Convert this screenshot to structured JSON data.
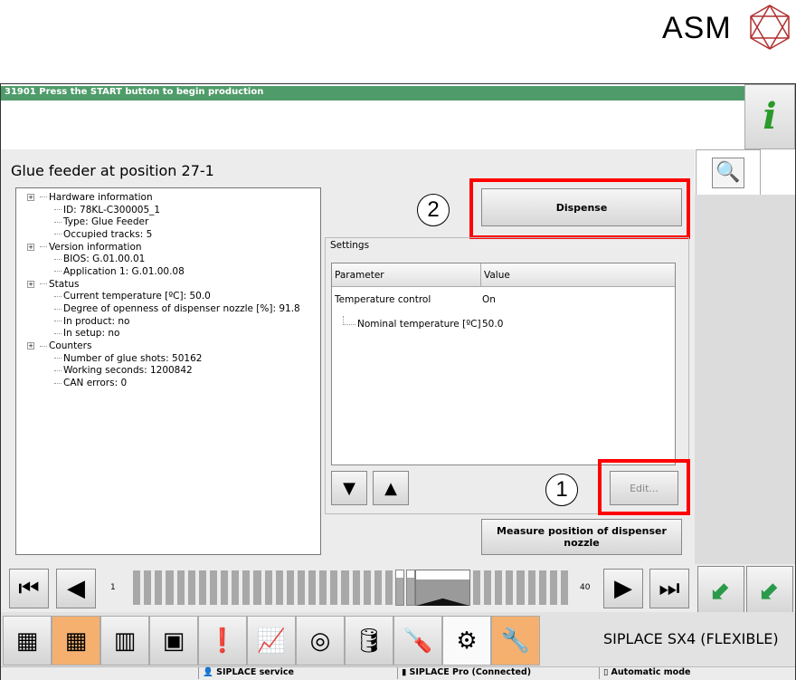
{
  "logo": {
    "text": "ASM"
  },
  "message": "31901 Press the START button to begin production",
  "title": "Glue feeder at position 27-1",
  "tree": [
    {
      "label": "Hardware information",
      "children": [
        "ID: 78KL-C300005_1",
        "Type: Glue Feeder",
        "Occupied tracks: 5"
      ]
    },
    {
      "label": "Version information",
      "children": [
        "BIOS: G.01.00.01",
        "Application 1: G.01.00.08"
      ]
    },
    {
      "label": "Status",
      "children": [
        "Current temperature [ºC]: 50.0",
        "Degree of openness of dispenser nozzle [%]: 91.8",
        "In product: no",
        "In setup: no"
      ]
    },
    {
      "label": "Counters",
      "children": [
        "Number of glue shots: 50162",
        "Working seconds: 1200842",
        "CAN errors: 0"
      ]
    }
  ],
  "buttons": {
    "dispense": "Dispense",
    "edit": "Edit...",
    "measure": "Measure position of dispenser nozzle"
  },
  "callouts": {
    "one": "1",
    "two": "2"
  },
  "settings": {
    "label": "Settings",
    "headers": [
      "Parameter",
      "Value"
    ],
    "rows": [
      [
        "Temperature control",
        "On"
      ],
      [
        "Nominal temperature [ºC]",
        "50.0"
      ]
    ]
  },
  "track": {
    "start": "1",
    "end": "40",
    "selected_from": 27,
    "selected_to": 31
  },
  "model": "SIPLACE SX4 (FLEXIBLE)",
  "statusbar": [
    "SIPLACE service",
    "SIPLACE Pro (Connected)",
    "Automatic mode"
  ],
  "colors": {
    "message_bar": "#4f9c6a",
    "highlight": "#ff0000",
    "active_tab": "#f5b070"
  }
}
